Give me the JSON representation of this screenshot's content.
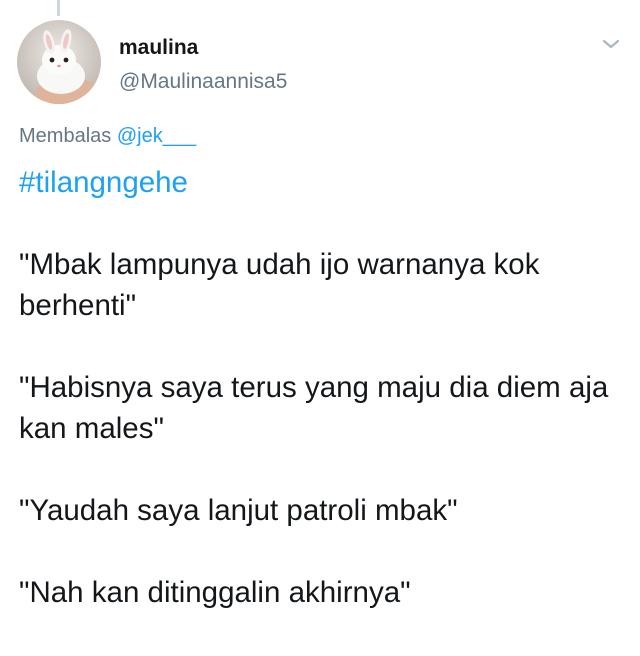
{
  "tweet": {
    "user": {
      "display_name": "maulina",
      "handle": "@Maulinaannisa5"
    },
    "reply_context": {
      "prefix": "Membalas",
      "mention": "@jek___"
    },
    "hashtag": "#tilangngehe",
    "paragraphs": [
      "\"Mbak lampunya udah ijo warnanya kok berhenti\"",
      "\"Habisnya saya terus yang maju dia diem aja kan males\"",
      "\"Yaudah saya lanjut patroli mbak\"",
      "\"Nah kan ditinggalin akhirnya\""
    ]
  },
  "icons": {
    "more": "chevron-down-icon",
    "avatar": "bunny-avatar"
  },
  "colors": {
    "accent": "#1da1f2",
    "secondary_text": "#657786",
    "primary_text": "#14171a",
    "thread_line": "#ccd6dd"
  }
}
